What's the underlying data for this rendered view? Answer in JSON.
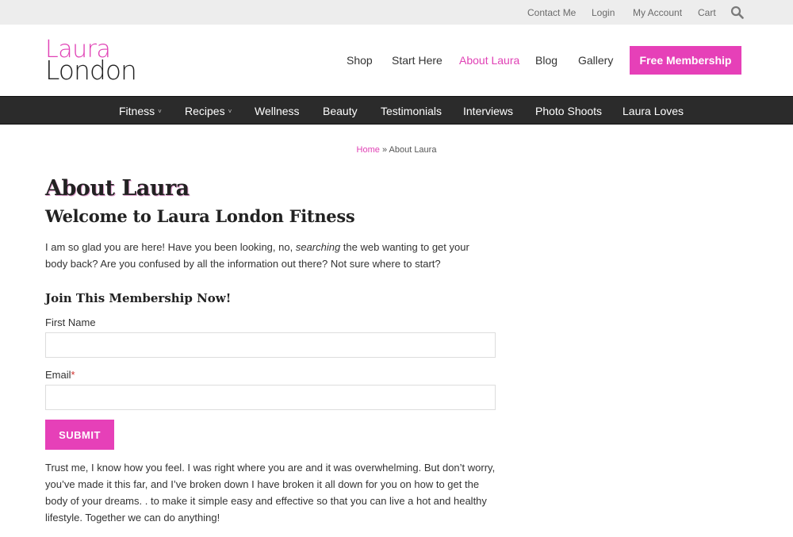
{
  "topbar": {
    "links": [
      "Contact Me",
      "Login",
      "My Account",
      "Cart"
    ],
    "search_icon": "search-icon"
  },
  "logo": {
    "line1": "Laura",
    "line2": "London"
  },
  "nav": {
    "items": [
      "Shop",
      "Start Here",
      "About Laura",
      "Blog",
      "Gallery"
    ],
    "active": "About Laura",
    "cta": "Free Membership"
  },
  "categories": {
    "items": [
      "Fitness",
      "Recipes",
      "Wellness",
      "Beauty",
      "Testimonials",
      "Interviews",
      "Photo Shoots",
      "Laura Loves"
    ],
    "dropdown_caret": "˅"
  },
  "breadcrumb": {
    "home": "Home",
    "separator": "»",
    "current": "About Laura"
  },
  "page": {
    "title": "About Laura",
    "welcome": "Welcome to Laura London Fitness",
    "intro_before": "I am so glad you are here! Have you been looking, no, ",
    "intro_em": "searching",
    "intro_after": " the web wanting to get your body back? Are you confused by all the information out there? Not sure where to start?"
  },
  "form": {
    "heading": "Join This Membership Now!",
    "first_name_label": "First Name",
    "first_name_value": "",
    "email_label": "Email",
    "email_required": "*",
    "email_value": "",
    "submit_label": "SUBMIT"
  },
  "body": {
    "trust": "Trust me, I know how you feel. I was right where you are and it was overwhelming. But don’t worry, you’ve made it this far, and I’ve broken down I have broken it all down for you on how to get the body of your dreams. . to make it simple easy and effective so that you can live a hot and healthy lifestyle. Together we can do anything!"
  },
  "colors": {
    "accent": "#e640b8",
    "topbar_bg": "#ededed",
    "catbar_bg": "#2b2b2b"
  }
}
